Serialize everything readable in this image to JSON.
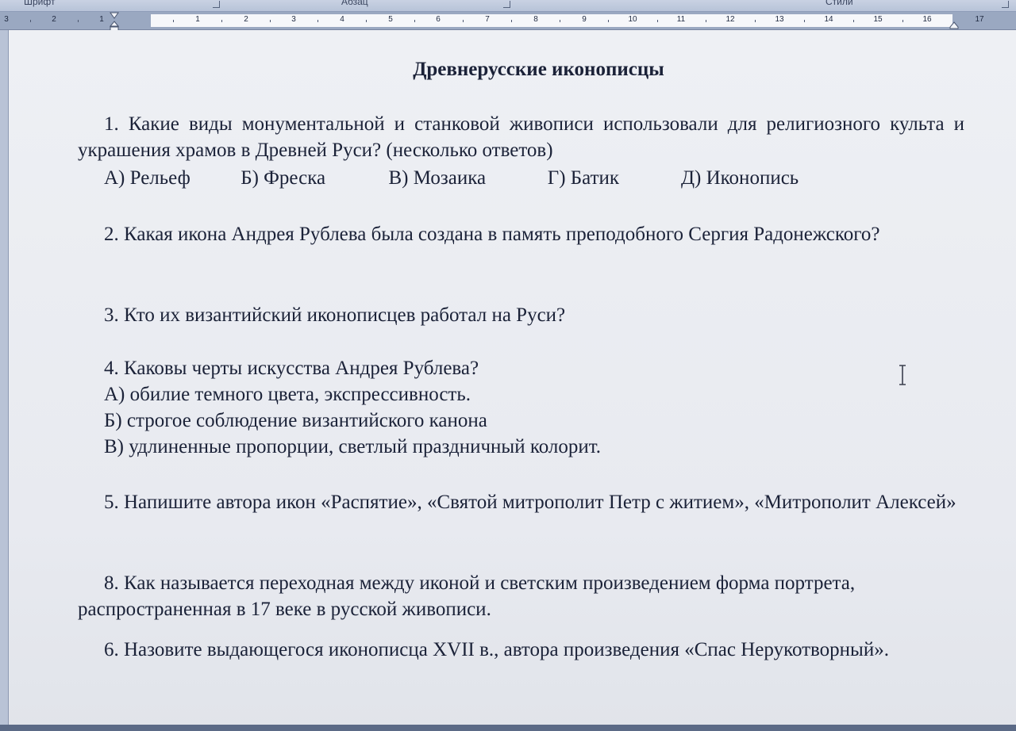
{
  "ribbon": {
    "groups": [
      {
        "label": "Шрифт"
      },
      {
        "label": "Абзац"
      },
      {
        "label": "Стили"
      }
    ]
  },
  "ruler": {
    "numbers": [
      "3",
      "2",
      "1",
      "1",
      "2",
      "3",
      "4",
      "5",
      "6",
      "7",
      "8",
      "9",
      "10",
      "11",
      "12",
      "13",
      "14",
      "15",
      "16",
      "17"
    ]
  },
  "document": {
    "title": "Древнерусские иконописцы",
    "q1": {
      "text": "1. Какие виды монументальной и станковой живописи использовали для религиозного культа и украшения храмов в Древней Руси? (несколько ответов)",
      "options": [
        "А) Рельеф",
        "Б) Фреска",
        "В) Мозаика",
        "Г) Батик",
        "Д) Иконопись"
      ]
    },
    "q2": "2. Какая икона Андрея Рублева была создана в память преподобного Сергия Радонежского?",
    "q3": "3. Кто их византийский иконописцев работал на Руси?",
    "q4": {
      "text": "4. Каковы черты искусства Андрея Рублева?",
      "options": [
        "А) обилие темного цвета, экспрессивность.",
        "Б) строгое соблюдение византийского канона",
        "В) удлиненные пропорции, светлый праздничный колорит."
      ]
    },
    "q5": "5. Напишите автора икон «Распятие», «Святой митрополит Петр с житием», «Митрополит Алексей»",
    "q8": "8. Как называется переходная между иконой и светским произведением форма портрета, распространенная в 17 веке в русской живописи.",
    "q6": "6. Назовите выдающегося иконописца XVII в., автора произведения «Спас Нерукотворный»."
  },
  "icons": {
    "cursor": "text-cursor-icon",
    "indent": "indent-marker-icon",
    "right_indent": "right-indent-marker-icon",
    "launcher": "dialog-launcher-icon"
  }
}
